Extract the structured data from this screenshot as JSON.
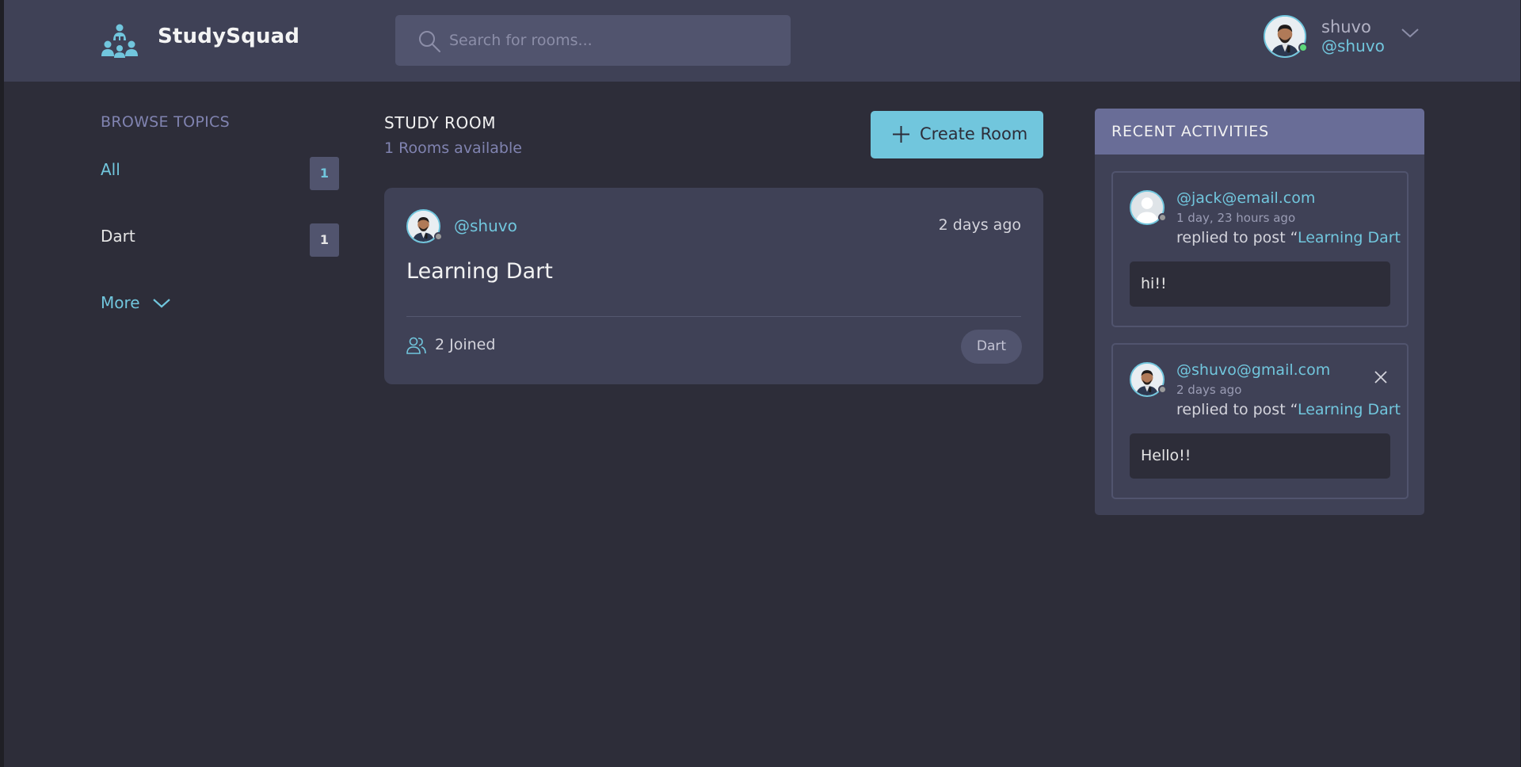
{
  "colors": {
    "accent": "#71c6dd",
    "header_bg": "#3f4156",
    "page_bg": "#2d2d39",
    "card_bg": "#3f4156",
    "activities_header_bg": "#696d97",
    "online": "#5dd87a",
    "offline": "#9a9a9a"
  },
  "header": {
    "brand": "StudySquad",
    "logo_icon": "team-logo-icon",
    "search": {
      "placeholder": "Search for rooms...",
      "value": "",
      "icon": "search-icon"
    },
    "user": {
      "name": "shuvo",
      "handle": "@shuvo",
      "status": "online",
      "menu_icon": "chevron-down-icon"
    }
  },
  "sidebar": {
    "title": "BROWSE TOPICS",
    "topics": [
      {
        "label": "All",
        "count": "1",
        "active": true
      },
      {
        "label": "Dart",
        "count": "1",
        "active": false
      }
    ],
    "more_label": "More"
  },
  "main": {
    "title": "STUDY ROOM",
    "rooms_available": "1 Rooms available",
    "create_button": "Create Room",
    "rooms": [
      {
        "host": "@shuvo",
        "time": "2 days ago",
        "title": "Learning Dart",
        "joined": "2 Joined",
        "topic": "Dart"
      }
    ]
  },
  "activities": {
    "title": "RECENT ACTIVITIES",
    "items": [
      {
        "user": "@jack@email.com",
        "time": "1 day, 23 hours ago",
        "action": "replied to post “",
        "post": "Learning Dart",
        "message": "hi!!",
        "avatar": "default-user-avatar",
        "deletable": false
      },
      {
        "user": "@shuvo@gmail.com",
        "time": "2 days ago",
        "action": "replied to post “",
        "post": "Learning Dart",
        "message": "Hello!!",
        "avatar": "user-photo-avatar",
        "deletable": true
      }
    ]
  }
}
